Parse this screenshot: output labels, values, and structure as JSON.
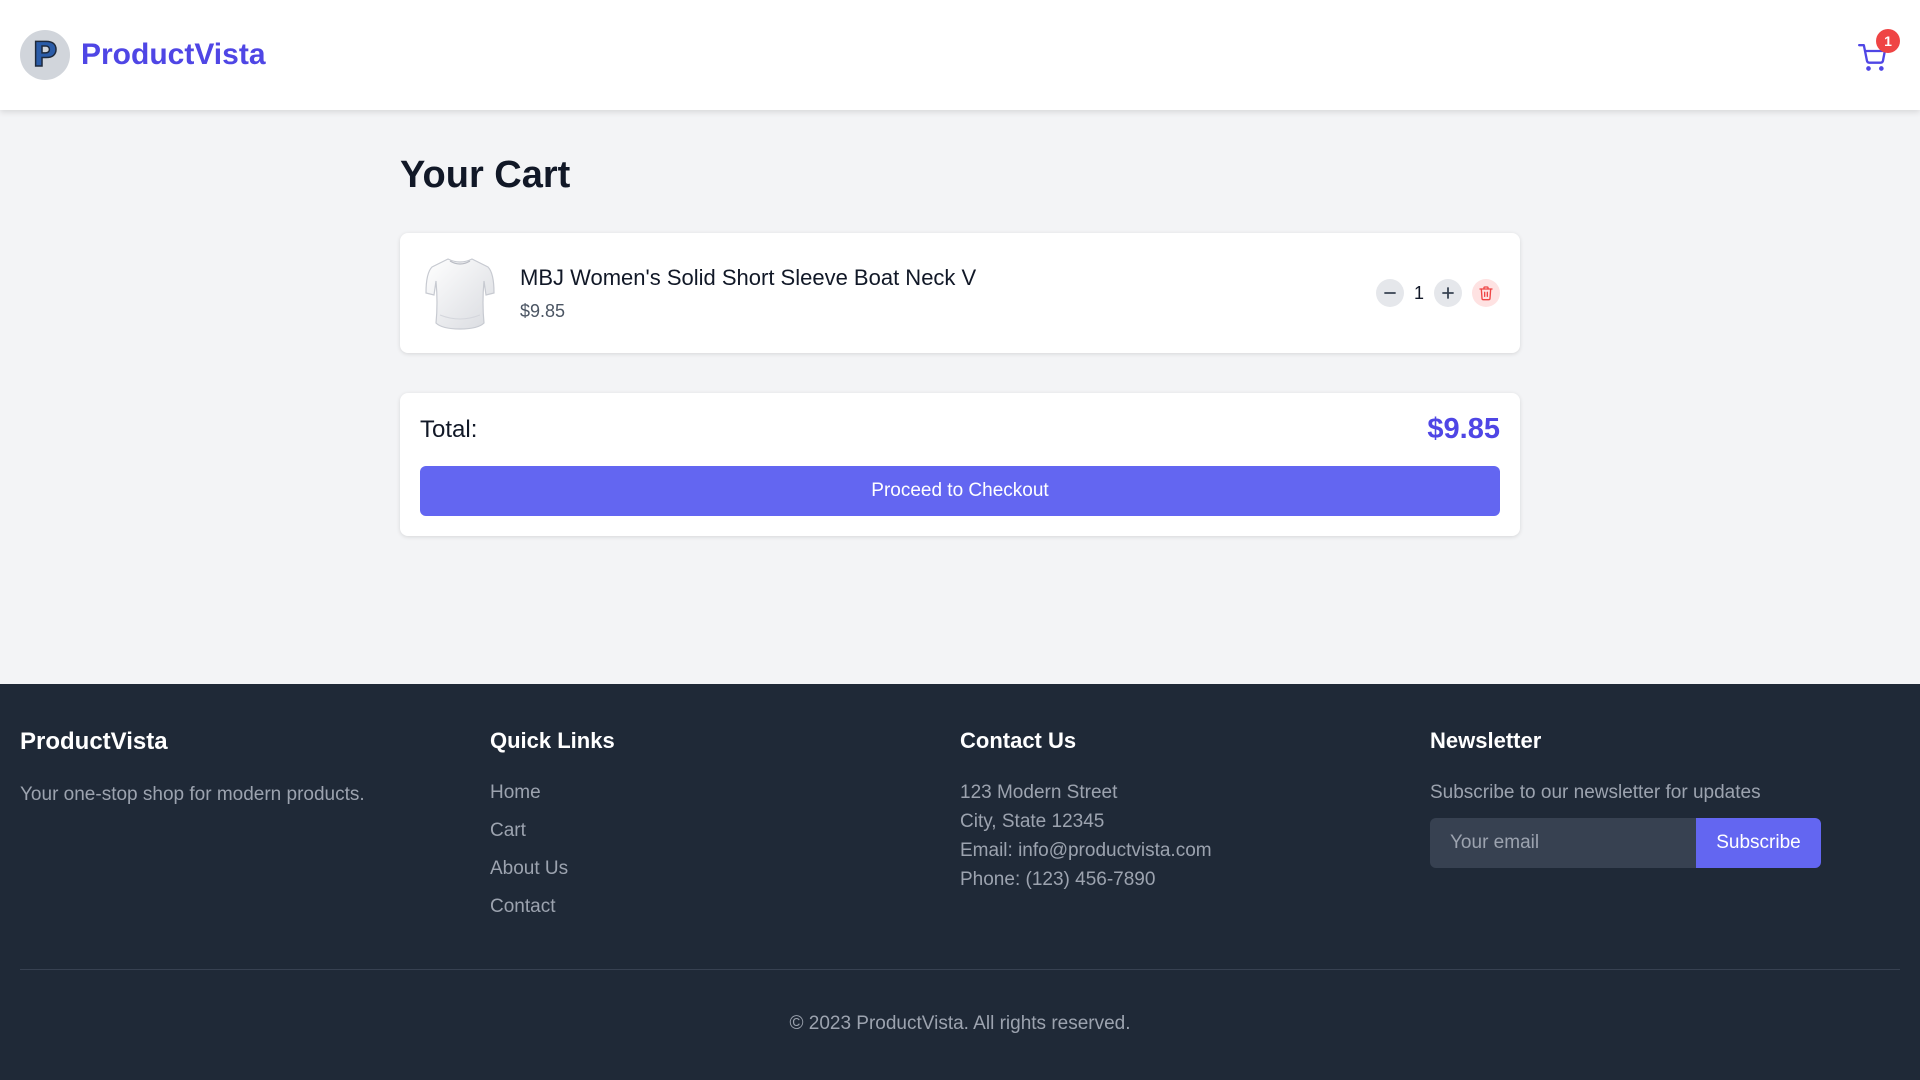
{
  "header": {
    "logo_letter": "P",
    "brand_name": "ProductVista",
    "cart_count": "1"
  },
  "main": {
    "title": "Your Cart",
    "cart_items": [
      {
        "name": "MBJ Women's Solid Short Sleeve Boat Neck V",
        "price": "$9.85",
        "quantity": "1",
        "image": "white-t-shirt"
      }
    ],
    "summary": {
      "total_label": "Total:",
      "total_value": "$9.85",
      "checkout_label": "Proceed to Checkout"
    }
  },
  "footer": {
    "brand": {
      "title": "ProductVista",
      "description": "Your one-stop shop for modern products."
    },
    "quick_links": {
      "title": "Quick Links",
      "items": [
        "Home",
        "Cart",
        "About Us",
        "Contact"
      ]
    },
    "contact": {
      "title": "Contact Us",
      "address": "123 Modern Street",
      "city": "City, State 12345",
      "email": "Email: info@productvista.com",
      "phone": "Phone: (123) 456-7890"
    },
    "newsletter": {
      "title": "Newsletter",
      "text": "Subscribe to our newsletter for updates",
      "placeholder": "Your email",
      "button": "Subscribe"
    },
    "copyright": "© 2023 ProductVista. All rights reserved."
  },
  "colors": {
    "accent": "#4f46e5",
    "button": "#6366f1",
    "badge": "#ef4444",
    "footer_bg": "#1f2937",
    "page_bg": "#f3f4f6"
  },
  "icons": {
    "cart": "shopping-cart-icon",
    "minus": "minus-icon",
    "plus": "plus-icon",
    "delete": "trash-icon"
  }
}
